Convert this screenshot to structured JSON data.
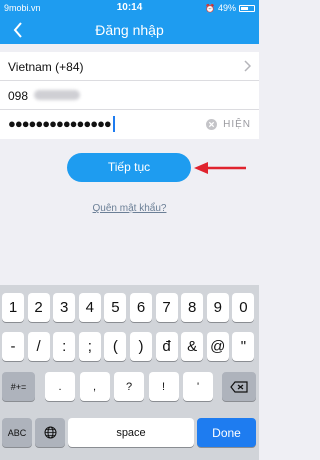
{
  "status": {
    "carrier": "9mobi.vn",
    "time": "10:14",
    "battery": "49%",
    "battery_level": 0.49
  },
  "nav": {
    "title": "Đăng nhập",
    "back_icon": "chevron-left-icon"
  },
  "form": {
    "country": "Vietnam (+84)",
    "phone_prefix": "098",
    "password_mask": "●●●●●●●●●●●●●●●",
    "show_label": "HIỆN"
  },
  "continue_label": "Tiếp tục",
  "forgot_label": "Quên mật khẩu?",
  "keyboard": {
    "row1": [
      "1",
      "2",
      "3",
      "4",
      "5",
      "6",
      "7",
      "8",
      "9",
      "0"
    ],
    "row2": [
      "-",
      "/",
      ":",
      ";",
      "(",
      ")",
      "đ",
      "&",
      "@",
      "\""
    ],
    "row3_mode": "#+=",
    "row3": [
      ".",
      ",",
      "?",
      "!",
      "'"
    ],
    "abc": "ABC",
    "space": "space",
    "done": "Done"
  },
  "colors": {
    "accent": "#1e9cf0",
    "arrow": "#e0232e",
    "done": "#1e7cf0"
  }
}
